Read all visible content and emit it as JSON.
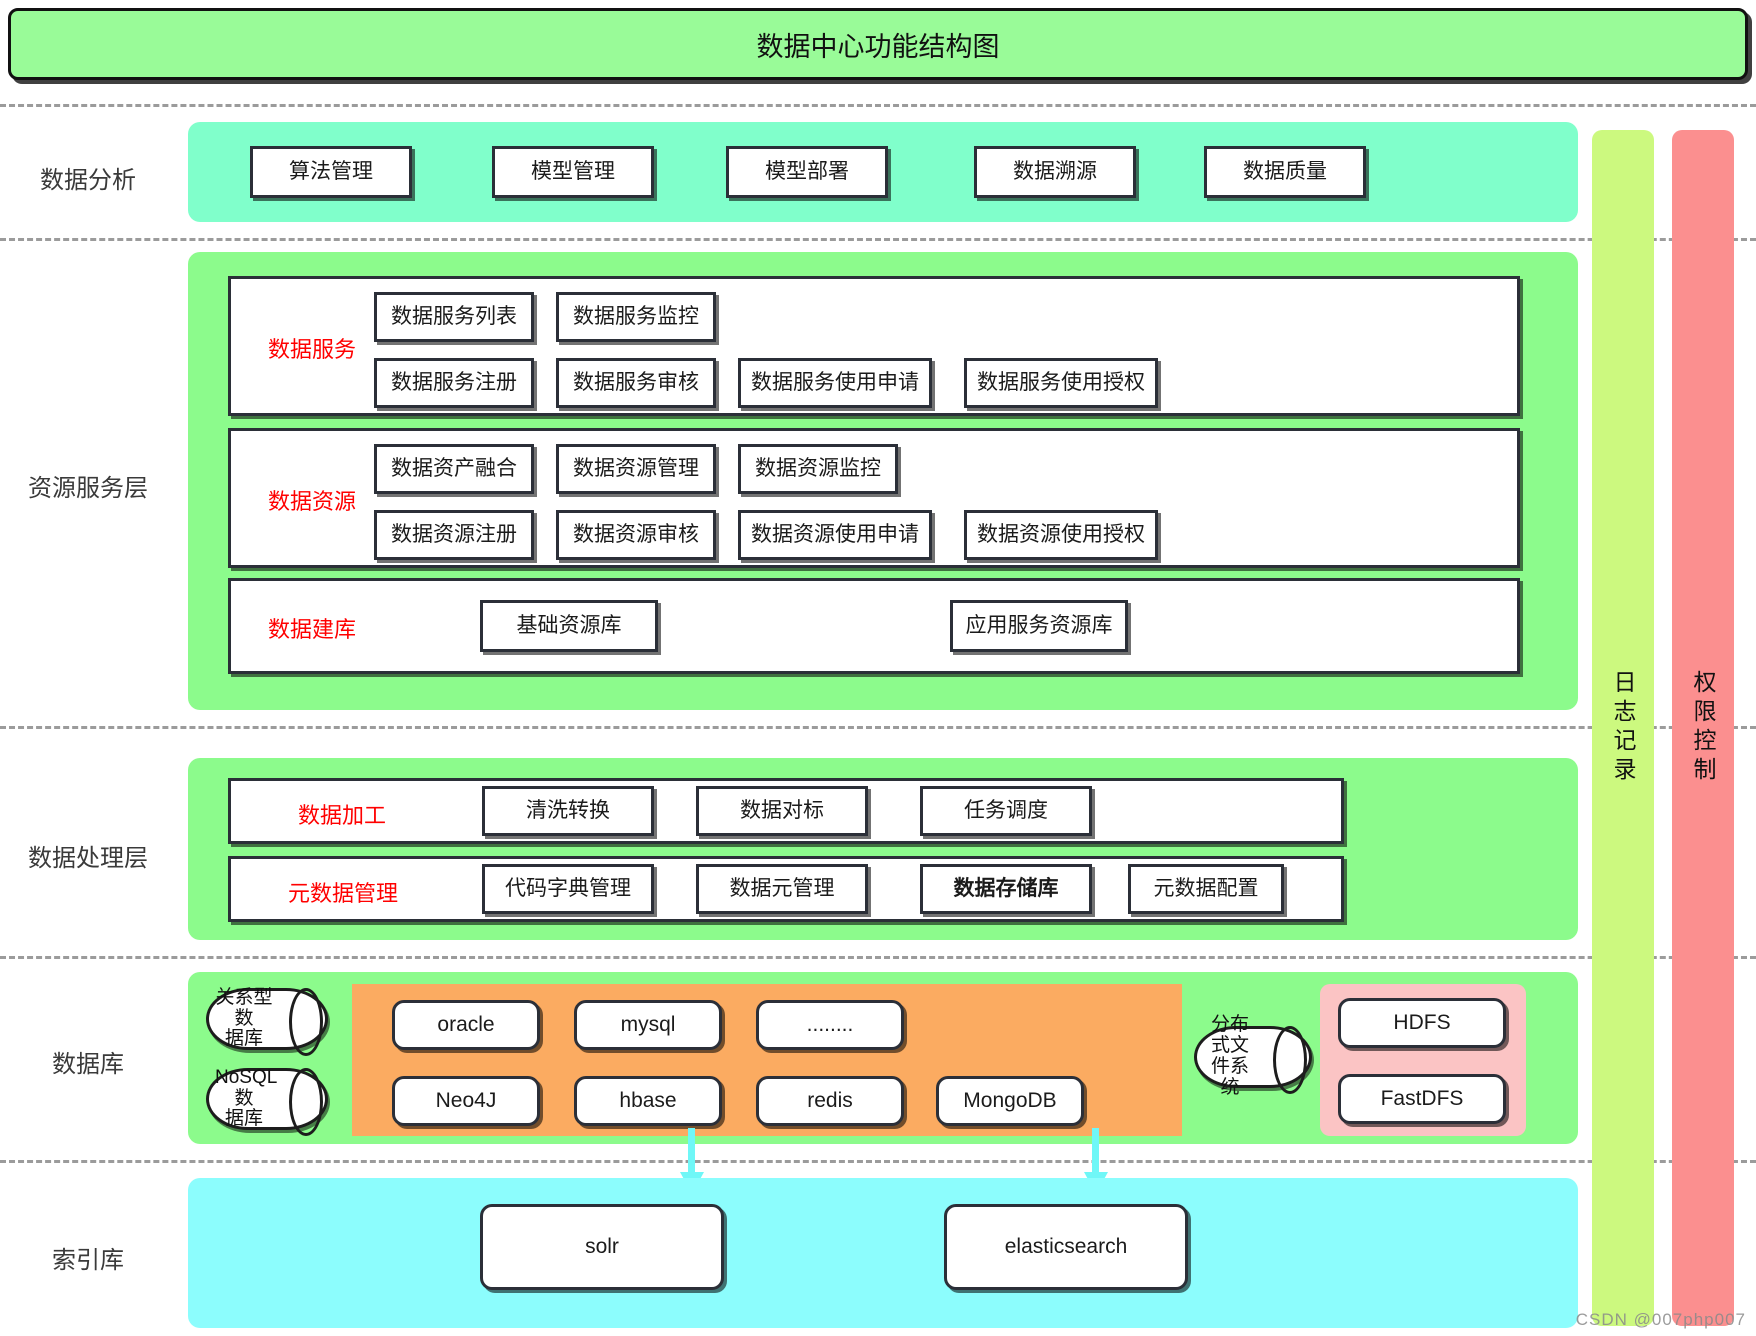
{
  "title": "数据中心功能结构图",
  "watermark": "CSDN @007php007",
  "layers": [
    {
      "label": "数据分析"
    },
    {
      "label": "资源服务层"
    },
    {
      "label": "数据处理层"
    },
    {
      "label": "数据库"
    },
    {
      "label": "索引库"
    }
  ],
  "analysis": {
    "items": [
      "算法管理",
      "模型管理",
      "模型部署",
      "数据溯源",
      "数据质量"
    ]
  },
  "resource": {
    "groups": [
      {
        "label": "数据服务",
        "row1": [
          "数据服务列表",
          "数据服务监控"
        ],
        "row2": [
          "数据服务注册",
          "数据服务审核",
          "数据服务使用申请",
          "数据服务使用授权"
        ]
      },
      {
        "label": "数据资源",
        "row1": [
          "数据资产融合",
          "数据资源管理",
          "数据资源监控"
        ],
        "row2": [
          "数据资源注册",
          "数据资源审核",
          "数据资源使用申请",
          "数据资源使用授权"
        ]
      },
      {
        "label": "数据建库",
        "row1": [
          "基础资源库",
          "应用服务资源库"
        ],
        "row2": []
      }
    ]
  },
  "process": {
    "groups": [
      {
        "label": "数据加工",
        "items": [
          {
            "text": "清洗转换",
            "bold": false
          },
          {
            "text": "数据对标",
            "bold": false
          },
          {
            "text": "任务调度",
            "bold": false
          }
        ]
      },
      {
        "label": "元数据管理",
        "items": [
          {
            "text": "代码字典管理",
            "bold": false
          },
          {
            "text": "数据元管理",
            "bold": false
          },
          {
            "text": "数据存储库",
            "bold": true
          },
          {
            "text": "元数据配置",
            "bold": false
          }
        ]
      }
    ]
  },
  "database": {
    "cylinders": [
      {
        "line1": "关系型数",
        "line2": "据库"
      },
      {
        "line1": "NoSQL数",
        "line2": "据库"
      }
    ],
    "fs_cylinder": {
      "line1": "分布式文",
      "line2": "件系统"
    },
    "relational": [
      "oracle",
      "mysql",
      "........"
    ],
    "nosql": [
      "Neo4J",
      "hbase",
      "redis",
      "MongoDB"
    ],
    "filesystems": [
      "HDFS",
      "FastDFS"
    ]
  },
  "index": {
    "items": [
      "solr",
      "elasticsearch"
    ]
  },
  "side_bars": [
    {
      "label": "日志记录",
      "color": "#ccf97f"
    },
    {
      "label": "权限控制",
      "color": "#fb8f8f"
    }
  ],
  "colors": {
    "title_bg": "#99fb98",
    "analysis_bg": "#80ffcb",
    "layer_bg": "#8cfb8c",
    "index_bg": "#8cfdfd",
    "orange_bg": "#fbab61",
    "pink_bg": "#fbc4c4",
    "group_label": "#ff0000",
    "arrow": "#6ff7f7"
  }
}
